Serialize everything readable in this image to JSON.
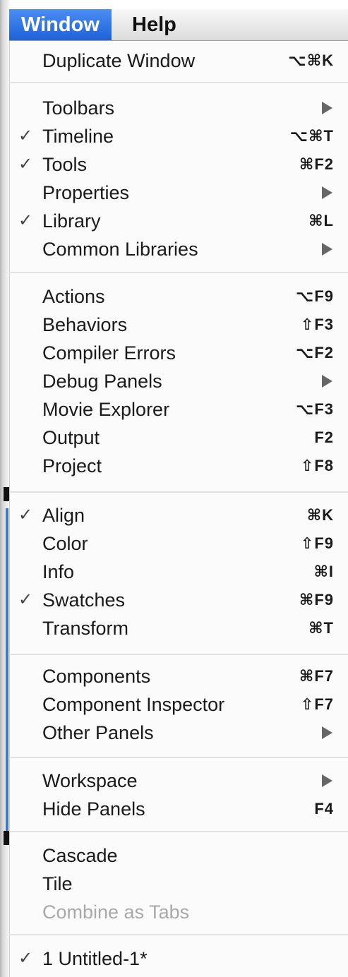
{
  "menubar": {
    "active_title": "Window",
    "help_title": "Help"
  },
  "menu": {
    "items": [
      {
        "label": "Duplicate Window",
        "shortcut": "⌥⌘K",
        "checked": false,
        "submenu": false,
        "disabled": false
      },
      {
        "label": "Toolbars",
        "shortcut": "",
        "checked": false,
        "submenu": true,
        "disabled": false
      },
      {
        "label": "Timeline",
        "shortcut": "⌥⌘T",
        "checked": true,
        "submenu": false,
        "disabled": false
      },
      {
        "label": "Tools",
        "shortcut": "⌘F2",
        "checked": true,
        "submenu": false,
        "disabled": false
      },
      {
        "label": "Properties",
        "shortcut": "",
        "checked": false,
        "submenu": true,
        "disabled": false
      },
      {
        "label": "Library",
        "shortcut": "⌘L",
        "checked": true,
        "submenu": false,
        "disabled": false
      },
      {
        "label": "Common Libraries",
        "shortcut": "",
        "checked": false,
        "submenu": true,
        "disabled": false
      },
      {
        "label": "Actions",
        "shortcut": "⌥F9",
        "checked": false,
        "submenu": false,
        "disabled": false
      },
      {
        "label": "Behaviors",
        "shortcut": "⇧F3",
        "checked": false,
        "submenu": false,
        "disabled": false
      },
      {
        "label": "Compiler Errors",
        "shortcut": "⌥F2",
        "checked": false,
        "submenu": false,
        "disabled": false
      },
      {
        "label": "Debug Panels",
        "shortcut": "",
        "checked": false,
        "submenu": true,
        "disabled": false
      },
      {
        "label": "Movie Explorer",
        "shortcut": "⌥F3",
        "checked": false,
        "submenu": false,
        "disabled": false
      },
      {
        "label": "Output",
        "shortcut": "F2",
        "checked": false,
        "submenu": false,
        "disabled": false
      },
      {
        "label": "Project",
        "shortcut": "⇧F8",
        "checked": false,
        "submenu": false,
        "disabled": false
      },
      {
        "label": "Align",
        "shortcut": "⌘K",
        "checked": true,
        "submenu": false,
        "disabled": false
      },
      {
        "label": "Color",
        "shortcut": "⇧F9",
        "checked": false,
        "submenu": false,
        "disabled": false
      },
      {
        "label": "Info",
        "shortcut": "⌘I",
        "checked": false,
        "submenu": false,
        "disabled": false
      },
      {
        "label": "Swatches",
        "shortcut": "⌘F9",
        "checked": true,
        "submenu": false,
        "disabled": false
      },
      {
        "label": "Transform",
        "shortcut": "⌘T",
        "checked": false,
        "submenu": false,
        "disabled": false
      },
      {
        "label": "Components",
        "shortcut": "⌘F7",
        "checked": false,
        "submenu": false,
        "disabled": false
      },
      {
        "label": "Component Inspector",
        "shortcut": "⇧F7",
        "checked": false,
        "submenu": false,
        "disabled": false
      },
      {
        "label": "Other Panels",
        "shortcut": "",
        "checked": false,
        "submenu": true,
        "disabled": false
      },
      {
        "label": "Workspace",
        "shortcut": "",
        "checked": false,
        "submenu": true,
        "disabled": false
      },
      {
        "label": "Hide Panels",
        "shortcut": "F4",
        "checked": false,
        "submenu": false,
        "disabled": false
      },
      {
        "label": "Cascade",
        "shortcut": "",
        "checked": false,
        "submenu": false,
        "disabled": false
      },
      {
        "label": "Tile",
        "shortcut": "",
        "checked": false,
        "submenu": false,
        "disabled": false
      },
      {
        "label": "Combine as Tabs",
        "shortcut": "",
        "checked": false,
        "submenu": false,
        "disabled": true
      },
      {
        "label": "1 Untitled-1*",
        "shortcut": "",
        "checked": true,
        "submenu": false,
        "disabled": false
      }
    ],
    "check_glyph": "✓"
  }
}
